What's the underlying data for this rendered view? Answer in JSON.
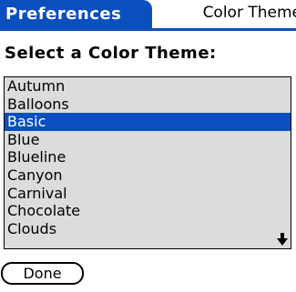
{
  "header": {
    "app_title": "Preferences",
    "screen_title": "Color Theme"
  },
  "heading": "Select a Color Theme:",
  "themes": {
    "items": [
      "Autumn",
      "Balloons",
      "Basic",
      "Blue",
      "Blueline",
      "Canyon",
      "Carnival",
      "Chocolate",
      "Clouds"
    ],
    "selected": "Basic"
  },
  "icons": {
    "scroll": "scroll-down-arrow-icon"
  },
  "buttons": {
    "done_label": "Done"
  },
  "colors": {
    "accent": "#0b4fbf",
    "list_background": "#dcdcdc"
  }
}
